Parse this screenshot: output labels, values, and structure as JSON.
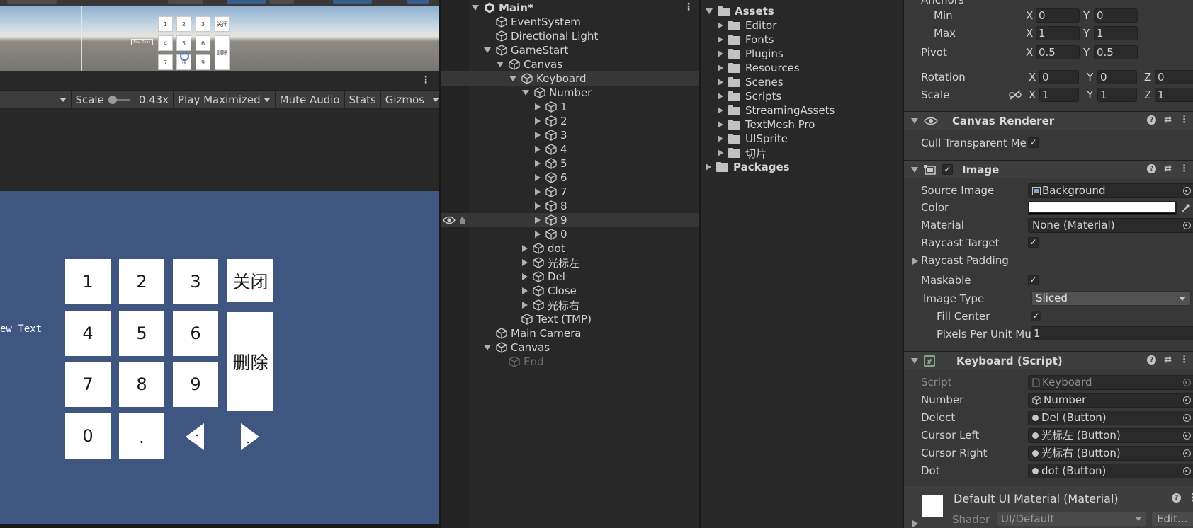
{
  "game_toolbar": {
    "scale_label": "Scale",
    "scale_value": "0.43x",
    "play_mode": "Play Maximized",
    "mute_audio": "Mute Audio",
    "stats": "Stats",
    "gizmos": "Gizmos"
  },
  "scene_view": {
    "mini_keys": [
      "1",
      "2",
      "3",
      "关闭",
      "4",
      "5",
      "6",
      "删除",
      "7",
      "8",
      "9"
    ],
    "mini_label": "New Text"
  },
  "game_view": {
    "new_text": "ew Text",
    "keys": {
      "k1": "1",
      "k2": "2",
      "k3": "3",
      "close": "关闭",
      "k4": "4",
      "k5": "5",
      "k6": "6",
      "delete": "删除",
      "k7": "7",
      "k8": "8",
      "k9": "9",
      "k0": "0",
      "dot": "."
    }
  },
  "hierarchy": {
    "items": [
      {
        "label": "Main*"
      },
      {
        "label": "EventSystem"
      },
      {
        "label": "Directional Light"
      },
      {
        "label": "GameStart"
      },
      {
        "label": "Canvas"
      },
      {
        "label": "Keyboard"
      },
      {
        "label": "Number"
      },
      {
        "label": "1"
      },
      {
        "label": "2"
      },
      {
        "label": "3"
      },
      {
        "label": "4"
      },
      {
        "label": "5"
      },
      {
        "label": "6"
      },
      {
        "label": "7"
      },
      {
        "label": "8"
      },
      {
        "label": "9"
      },
      {
        "label": "0"
      },
      {
        "label": "dot"
      },
      {
        "label": "光标左"
      },
      {
        "label": "Del"
      },
      {
        "label": "Close"
      },
      {
        "label": "光标右"
      },
      {
        "label": "Text (TMP)"
      },
      {
        "label": "Main Camera"
      },
      {
        "label": "Canvas"
      },
      {
        "label": "End"
      }
    ]
  },
  "project": {
    "items": [
      {
        "label": "Assets"
      },
      {
        "label": "Editor"
      },
      {
        "label": "Fonts"
      },
      {
        "label": "Plugins"
      },
      {
        "label": "Resources"
      },
      {
        "label": "Scenes"
      },
      {
        "label": "Scripts"
      },
      {
        "label": "StreamingAssets"
      },
      {
        "label": "TextMesh Pro"
      },
      {
        "label": "UISprite"
      },
      {
        "label": "切片"
      },
      {
        "label": "Packages"
      }
    ]
  },
  "inspector": {
    "anchors": {
      "label": "Anchors",
      "min_label": "Min",
      "min_x": "0",
      "min_y": "0",
      "max_label": "Max",
      "max_x": "1",
      "max_y": "1"
    },
    "pivot": {
      "label": "Pivot",
      "x": "0.5",
      "y": "0.5"
    },
    "rotation": {
      "label": "Rotation",
      "x": "0",
      "y": "0",
      "z": "0"
    },
    "scale": {
      "label": "Scale",
      "x": "1",
      "y": "1",
      "z": "1"
    },
    "axis": {
      "x": "X",
      "y": "Y",
      "z": "Z"
    },
    "canvas_renderer": {
      "title": "Canvas Renderer",
      "cull_label": "Cull Transparent Me",
      "cull_checked": "✓"
    },
    "image": {
      "title": "Image",
      "enabled_check": "✓",
      "source_image_label": "Source Image",
      "source_image_value": "Background",
      "color_label": "Color",
      "color_value": "#ffffff",
      "material_label": "Material",
      "material_value": "None (Material)",
      "raycast_target_label": "Raycast Target",
      "raycast_target_check": "✓",
      "raycast_padding_label": "Raycast Padding",
      "maskable_label": "Maskable",
      "maskable_check": "✓",
      "image_type_label": "Image Type",
      "image_type_value": "Sliced",
      "fill_center_label": "Fill Center",
      "fill_center_check": "✓",
      "ppu_label": "Pixels Per Unit Mu",
      "ppu_value": "1"
    },
    "keyboard_script": {
      "title": "Keyboard (Script)",
      "script_label": "Script",
      "script_value": "Keyboard",
      "number_label": "Number",
      "number_value": "Number",
      "delect_label": "Delect",
      "delect_value": "Del (Button)",
      "cursor_left_label": "Cursor Left",
      "cursor_left_value": "光标左 (Button)",
      "cursor_right_label": "Cursor Right",
      "cursor_right_value": "光标右 (Button)",
      "dot_label": "Dot",
      "dot_value": "dot (Button)"
    },
    "material": {
      "title": "Default UI Material (Material)",
      "shader_label": "Shader",
      "shader_value": "UI/Default",
      "edit_label": "Edit..."
    }
  }
}
